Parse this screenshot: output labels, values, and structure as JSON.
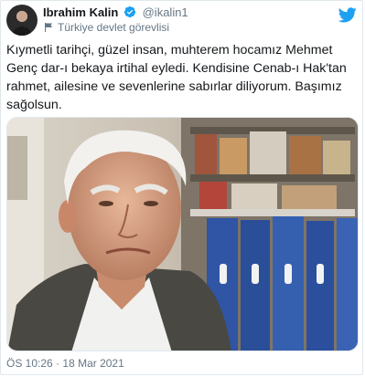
{
  "header": {
    "display_name": "Ibrahim Kalin",
    "handle": "@ikalin1",
    "label": "Türkiye devlet görevlisi",
    "avatar_icon": "profile-avatar",
    "verified_icon": "verified-badge-icon",
    "logo_icon": "twitter-bird-icon"
  },
  "tweet": {
    "text": "Kıymetli tarihçi, güzel insan, muhterem hocamız Mehmet Genç dar-ı bekaya irtihal eyledi. Kendisine Cenab-ı Hak'tan rahmet, ailesine ve sevenlerine sabırlar diliyorum. Başımız sağolsun.",
    "time": "ÖS 10:26",
    "separator": "·",
    "date": "18 Mar 2021"
  },
  "colors": {
    "text": "#14171a",
    "muted": "#657786",
    "accent": "#1da1f2",
    "border": "#e1e8ed"
  }
}
